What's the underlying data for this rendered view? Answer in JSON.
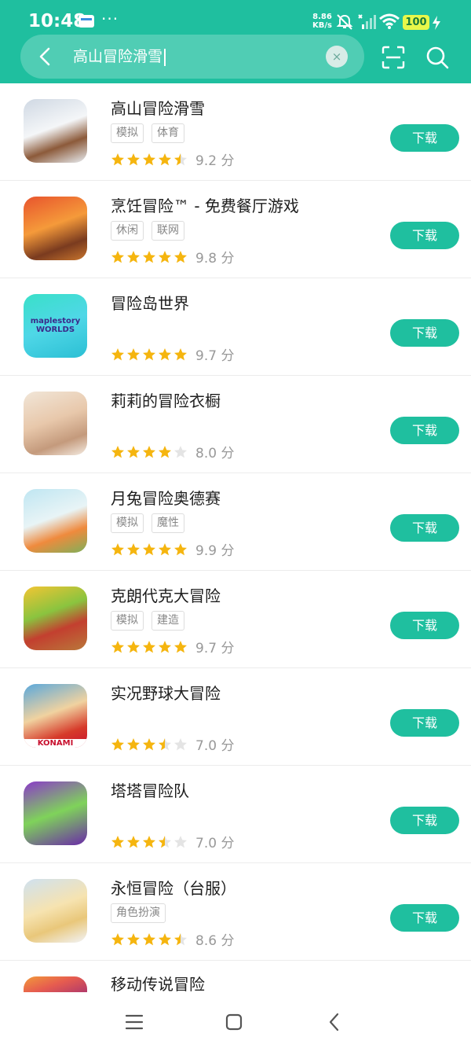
{
  "status_bar": {
    "time": "10:48",
    "dots": "···",
    "speed_value": "8.86",
    "speed_unit": "KB/s",
    "battery": "100",
    "icons": [
      "app-notification-icon",
      "bell-muted-icon",
      "signal-icon",
      "wifi-icon",
      "battery-icon",
      "charging-icon"
    ]
  },
  "search": {
    "query": "高山冒险滑雪",
    "clear_symbol": "×",
    "icons": [
      "back-arrow-icon",
      "clear-icon",
      "scan-icon",
      "search-icon"
    ]
  },
  "colors": {
    "accent": "#1fbf9f",
    "star": "#f5b50f",
    "star_empty": "#e4e4e4"
  },
  "results": [
    {
      "name": "高山冒险滑雪",
      "tags": [
        "模拟",
        "体育"
      ],
      "score": "9.2 分",
      "stars": 4.5,
      "download": "下载"
    },
    {
      "name": "烹饪冒险™ - 免费餐厅游戏",
      "tags": [
        "休闲",
        "联网"
      ],
      "score": "9.8 分",
      "stars": 5,
      "download": "下载"
    },
    {
      "name": "冒险岛世界",
      "tags": [],
      "score": "9.7 分",
      "stars": 5,
      "download": "下载",
      "icon_text": "maplestory WORLDS"
    },
    {
      "name": "莉莉的冒险衣橱",
      "tags": [],
      "score": "8.0 分",
      "stars": 4,
      "download": "下载"
    },
    {
      "name": "月兔冒险奥德赛",
      "tags": [
        "模拟",
        "魔性"
      ],
      "score": "9.9 分",
      "stars": 5,
      "download": "下载"
    },
    {
      "name": "克朗代克大冒险",
      "tags": [
        "模拟",
        "建造"
      ],
      "score": "9.7 分",
      "stars": 5,
      "download": "下载"
    },
    {
      "name": "实况野球大冒险",
      "tags": [],
      "score": "7.0 分",
      "stars": 3.5,
      "download": "下载",
      "icon_text": "KONAMI"
    },
    {
      "name": "塔塔冒险队",
      "tags": [],
      "score": "7.0 分",
      "stars": 3.5,
      "download": "下载"
    },
    {
      "name": "永恒冒险（台服）",
      "tags": [
        "角色扮演"
      ],
      "score": "8.6 分",
      "stars": 4.5,
      "download": "下载"
    },
    {
      "name": "移动传说冒险",
      "tags": [],
      "score": "",
      "stars": 0,
      "download": ""
    }
  ],
  "nav_bar": {
    "icons": [
      "menu-icon",
      "home-icon",
      "back-icon"
    ]
  }
}
